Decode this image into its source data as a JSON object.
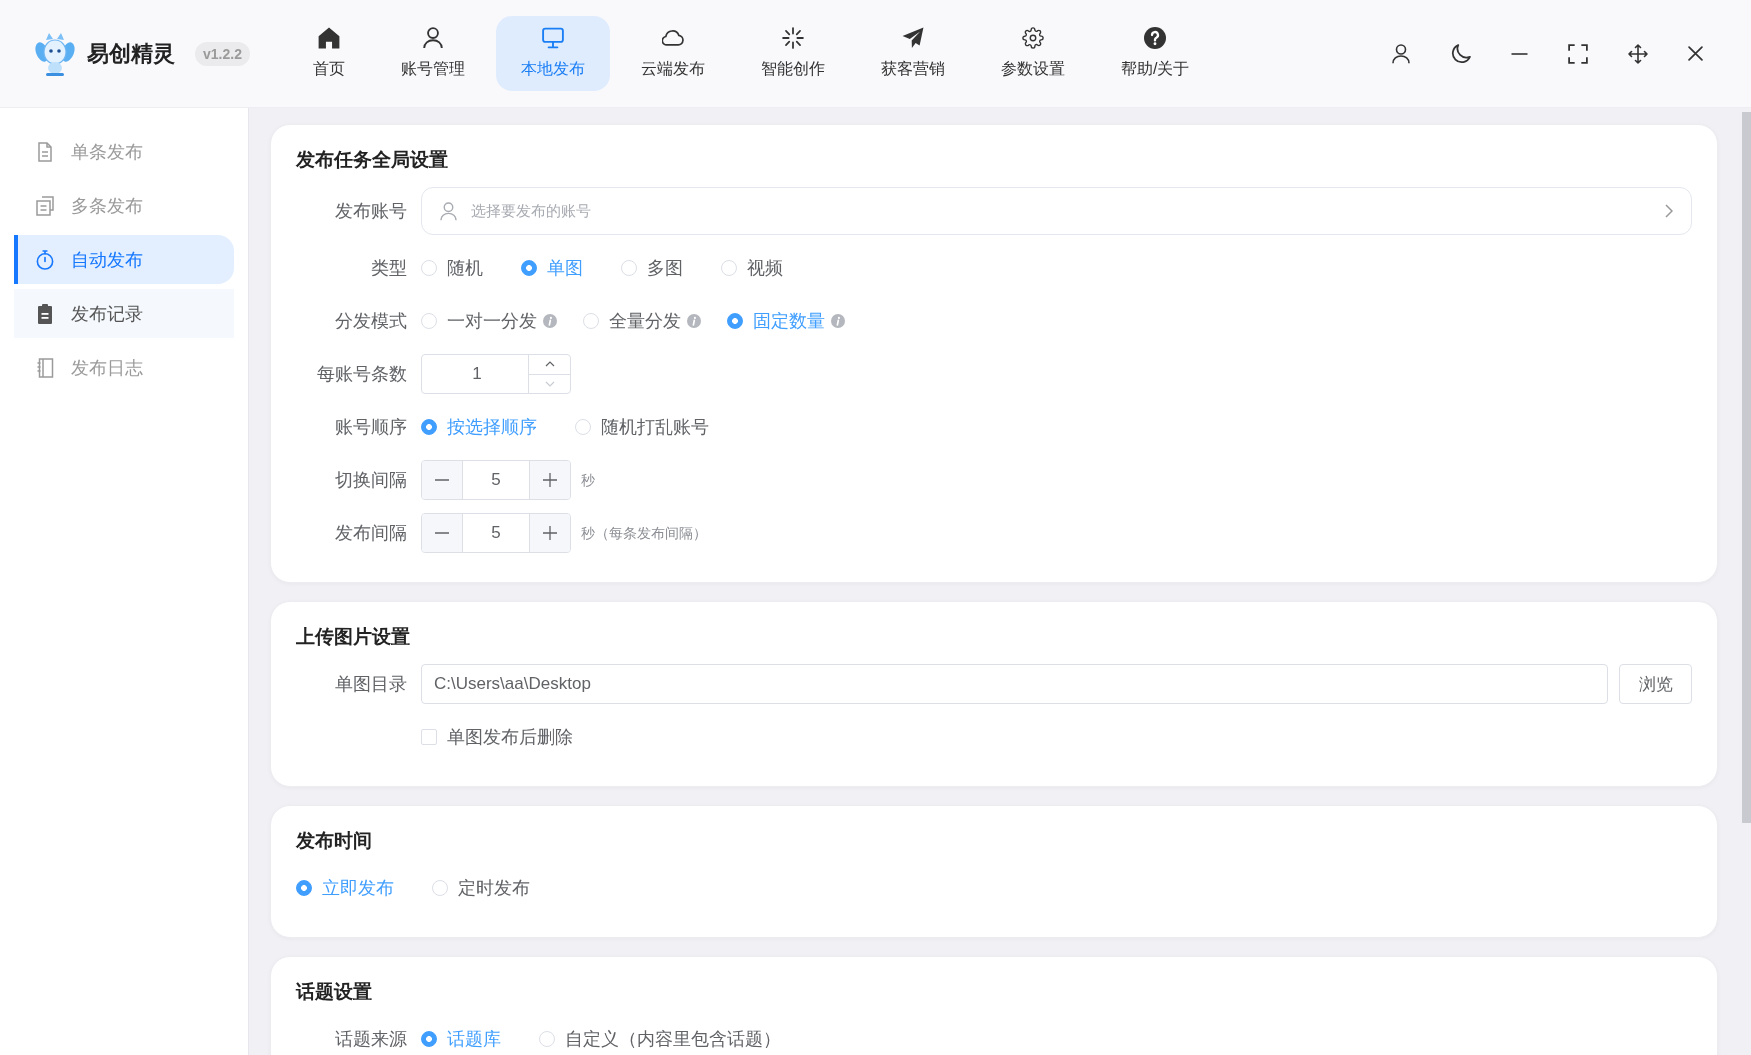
{
  "app": {
    "name": "易创精灵",
    "version": "v1.2.2"
  },
  "nav": [
    {
      "label": "首页",
      "selected": false
    },
    {
      "label": "账号管理",
      "selected": false
    },
    {
      "label": "本地发布",
      "selected": true
    },
    {
      "label": "云端发布",
      "selected": false
    },
    {
      "label": "智能创作",
      "selected": false
    },
    {
      "label": "获客营销",
      "selected": false
    },
    {
      "label": "参数设置",
      "selected": false
    },
    {
      "label": "帮助/关于",
      "selected": false
    }
  ],
  "sidebar": {
    "items": [
      {
        "label": "单条发布",
        "selected": false,
        "hovered": false
      },
      {
        "label": "多条发布",
        "selected": false,
        "hovered": false
      },
      {
        "label": "自动发布",
        "selected": true,
        "hovered": false
      },
      {
        "label": "发布记录",
        "selected": false,
        "hovered": true
      },
      {
        "label": "发布日志",
        "selected": false,
        "hovered": false
      }
    ]
  },
  "cards": [
    {
      "title": "发布任务全局设置",
      "rows": [
        {
          "kind": "select",
          "label": "发布账号",
          "placeholder": "选择要发布的账号"
        },
        {
          "kind": "radio",
          "label": "类型",
          "options": [
            {
              "label": "随机",
              "selected": false
            },
            {
              "label": "单图",
              "selected": true
            },
            {
              "label": "多图",
              "selected": false
            },
            {
              "label": "视频",
              "selected": false
            }
          ]
        },
        {
          "kind": "radio",
          "label": "分发模式",
          "options": [
            {
              "label": "一对一分发",
              "selected": false,
              "info": true
            },
            {
              "label": "全量分发",
              "selected": false,
              "info": true
            },
            {
              "label": "固定数量",
              "selected": true,
              "info": true
            }
          ]
        },
        {
          "kind": "number",
          "label": "每账号条数",
          "value": "1",
          "decrease_disabled": true
        },
        {
          "kind": "radio",
          "label": "账号顺序",
          "options": [
            {
              "label": "按选择顺序",
              "selected": true
            },
            {
              "label": "随机打乱账号",
              "selected": false
            }
          ]
        },
        {
          "kind": "stepper",
          "label": "切换间隔",
          "value": "5",
          "unit": "秒"
        },
        {
          "kind": "stepper",
          "label": "发布间隔",
          "value": "5",
          "unit": "秒（每条发布间隔）"
        }
      ]
    },
    {
      "title": "上传图片设置",
      "rows": [
        {
          "kind": "path",
          "label": "单图目录",
          "value": "C:\\Users\\aa\\Desktop",
          "button": "浏览"
        },
        {
          "kind": "checkbox",
          "text": "单图发布后删除",
          "checked": false
        }
      ]
    },
    {
      "title": "发布时间",
      "rows": [
        {
          "kind": "radio",
          "options": [
            {
              "label": "立即发布",
              "selected": true
            },
            {
              "label": "定时发布",
              "selected": false
            }
          ]
        }
      ]
    },
    {
      "title": "话题设置",
      "rows": [
        {
          "kind": "radio",
          "label": "话题来源",
          "options": [
            {
              "label": "话题库",
              "selected": true
            },
            {
              "label": "自定义（内容里包含话题）",
              "selected": false
            }
          ]
        }
      ]
    }
  ]
}
